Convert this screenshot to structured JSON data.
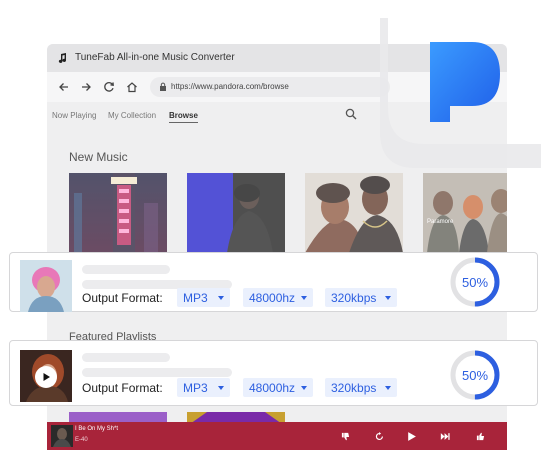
{
  "window": {
    "title": "TuneFab All-in-one Music Converter",
    "url": "https://www.pandora.com/browse"
  },
  "tabs": [
    {
      "label": "Now Playing"
    },
    {
      "label": "My Collection"
    },
    {
      "label": "Browse",
      "active": true
    }
  ],
  "sections": {
    "new_music": "New Music",
    "featured_playlists": "Featured Playlists"
  },
  "tiles": [
    {
      "art_text": "1-800 HOTEL"
    },
    {
      "art_text": ""
    },
    {
      "art_text": ""
    },
    {
      "art_text": "Paramore"
    }
  ],
  "converter": [
    {
      "format_label": "Output Format:",
      "format": "MP3",
      "sample_rate": "48000hz",
      "bitrate": "320kbps",
      "progress": 50,
      "progress_text": "50%"
    },
    {
      "format_label": "Output Format:",
      "format": "MP3",
      "sample_rate": "48000hz",
      "bitrate": "320kbps",
      "progress": 50,
      "progress_text": "50%"
    }
  ],
  "player": {
    "track": "I Be On My Sh*t",
    "time": "E-40"
  },
  "colors": {
    "accent": "#2d5fe0",
    "player_bg": "#a8243a",
    "pandora_blue_top": "#3b9bff",
    "pandora_blue_bottom": "#1f5ee8"
  }
}
